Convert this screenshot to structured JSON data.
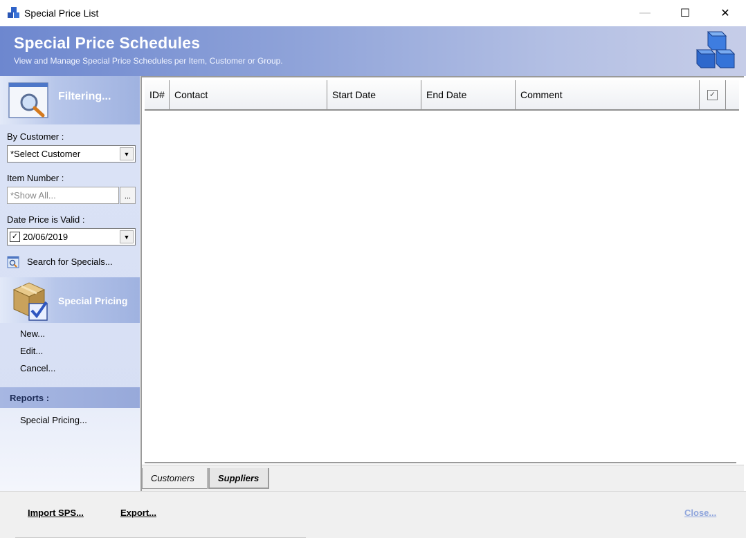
{
  "window": {
    "title": "Special Price List",
    "controls": {
      "minimize": "—",
      "maximize": "☐",
      "close": "✕"
    }
  },
  "header": {
    "title": "Special Price Schedules",
    "subtitle": "View and Manage Special Price Schedules per Item, Customer or Group."
  },
  "filter": {
    "heading": "Filtering...",
    "by_customer_label": "By Customer :",
    "customer_value": "*Select Customer",
    "item_number_label": "Item Number :",
    "item_number_placeholder": "*Show All...",
    "item_browse_label": "...",
    "date_label": "Date Price is Valid :",
    "date_checked": true,
    "date_check_mark": "✓",
    "date_value": "20/06/2019",
    "search_link": "Search for Specials..."
  },
  "special_pricing": {
    "heading": "Special Pricing",
    "actions": [
      "New...",
      "Edit...",
      "Cancel..."
    ]
  },
  "reports": {
    "heading": "Reports :",
    "items": [
      "Special Pricing..."
    ]
  },
  "grid": {
    "columns": [
      "ID#",
      "Contact",
      "Start Date",
      "End Date",
      "Comment"
    ],
    "check_column_mark": "✓",
    "rows": []
  },
  "tabs": {
    "customers": "Customers",
    "suppliers": "Suppliers",
    "active": "suppliers"
  },
  "footer": {
    "import_label": "Import SPS...",
    "export_label": "Export...",
    "close_label": "Close..."
  },
  "colors": {
    "banner_start": "#6d87cf",
    "banner_end": "#c6cde8",
    "close_link": "#8fa5dc"
  }
}
